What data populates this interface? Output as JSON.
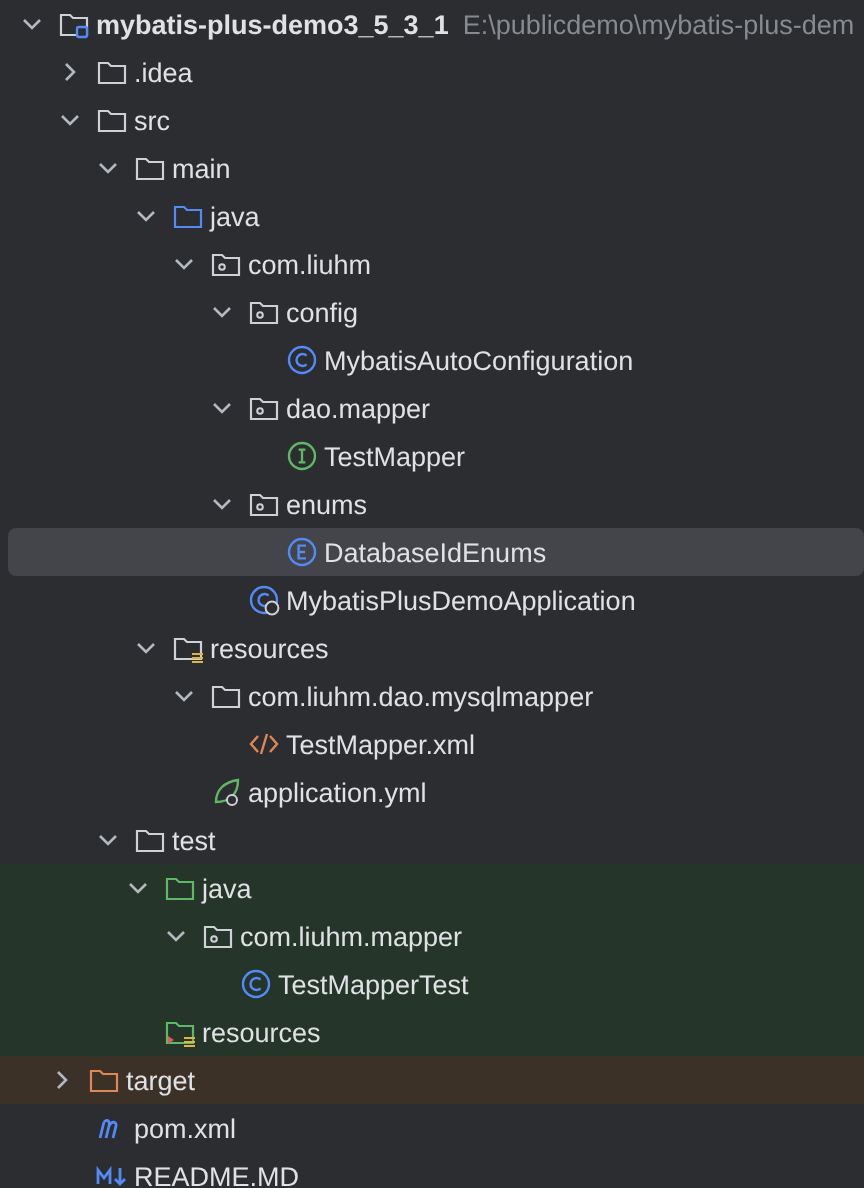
{
  "project_tree": [
    {
      "name": "mybatis-plus-demo3_5_3_1",
      "path": "E:\\publicdemo\\mybatis-plus-dem",
      "kind": "module",
      "expanded": true,
      "selected": false,
      "children": [
        {
          "name": ".idea",
          "kind": "folder",
          "expanded": false,
          "selected": false
        },
        {
          "name": "src",
          "kind": "folder",
          "expanded": true,
          "selected": false,
          "children": [
            {
              "name": "main",
              "kind": "folder",
              "expanded": true,
              "selected": false,
              "children": [
                {
                  "name": "java",
                  "kind": "source-folder",
                  "expanded": true,
                  "selected": false,
                  "children": [
                    {
                      "name": "com.liuhm",
                      "kind": "package",
                      "expanded": true,
                      "selected": false,
                      "children": [
                        {
                          "name": "config",
                          "kind": "package",
                          "expanded": true,
                          "selected": false,
                          "children": [
                            {
                              "name": "MybatisAutoConfiguration",
                              "kind": "class",
                              "selected": false
                            }
                          ]
                        },
                        {
                          "name": "dao.mapper",
                          "kind": "package",
                          "expanded": true,
                          "selected": false,
                          "children": [
                            {
                              "name": "TestMapper",
                              "kind": "interface",
                              "selected": false
                            }
                          ]
                        },
                        {
                          "name": "enums",
                          "kind": "package",
                          "expanded": true,
                          "selected": false,
                          "children": [
                            {
                              "name": "DatabaseIdEnums",
                              "kind": "enum",
                              "selected": true
                            }
                          ]
                        },
                        {
                          "name": "MybatisPlusDemoApplication",
                          "kind": "app-class",
                          "selected": false
                        }
                      ]
                    }
                  ]
                },
                {
                  "name": "resources",
                  "kind": "resources-folder",
                  "expanded": true,
                  "selected": false,
                  "children": [
                    {
                      "name": "com.liuhm.dao.mysqlmapper",
                      "kind": "folder",
                      "expanded": true,
                      "selected": false,
                      "children": [
                        {
                          "name": "TestMapper.xml",
                          "kind": "xml",
                          "selected": false
                        }
                      ]
                    },
                    {
                      "name": "application.yml",
                      "kind": "yaml",
                      "selected": false
                    }
                  ]
                }
              ]
            },
            {
              "name": "test",
              "kind": "folder",
              "expanded": true,
              "selected": false,
              "children": [
                {
                  "name": "java",
                  "kind": "test-folder",
                  "color": "#25352a",
                  "expanded": true,
                  "selected": false,
                  "children": [
                    {
                      "name": "com.liuhm.mapper",
                      "kind": "package",
                      "color": "#25352a",
                      "expanded": true,
                      "selected": false,
                      "children": [
                        {
                          "name": "TestMapperTest",
                          "kind": "class",
                          "color": "#25352a",
                          "selected": false
                        }
                      ]
                    }
                  ]
                },
                {
                  "name": "resources",
                  "kind": "test-resources",
                  "color": "#25352a",
                  "selected": false
                }
              ]
            }
          ]
        },
        {
          "name": "target",
          "kind": "excluded-folder",
          "color": "#3c3126",
          "expanded": false,
          "selected": false
        },
        {
          "name": "pom.xml",
          "kind": "maven",
          "selected": false
        },
        {
          "name": "README.MD",
          "kind": "markdown",
          "selected": false
        }
      ]
    }
  ]
}
